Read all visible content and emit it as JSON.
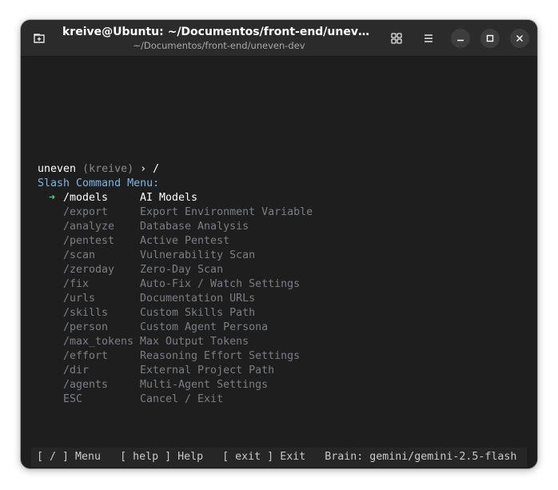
{
  "window": {
    "title": "kreive@Ubuntu: ~/Documentos/front-end/uneven-d...",
    "subtitle": "~/Documentos/front-end/uneven-dev"
  },
  "icons": {
    "new_tab": "new-tab-icon",
    "grid": "grid-icon",
    "menu": "hamburger-menu-icon",
    "minimize": "minimize-icon",
    "maximize": "maximize-icon",
    "close": "close-icon"
  },
  "prompt": {
    "app": "uneven",
    "user": "(kreive)",
    "arrow": "›",
    "input": "/"
  },
  "menu_title": "Slash Command Menu:",
  "selector": "➜",
  "commands": [
    {
      "cmd": "/models",
      "desc": "AI Models"
    },
    {
      "cmd": "/export",
      "desc": "Export Environment Variable"
    },
    {
      "cmd": "/analyze",
      "desc": "Database Analysis"
    },
    {
      "cmd": "/pentest",
      "desc": "Active Pentest"
    },
    {
      "cmd": "/scan",
      "desc": "Vulnerability Scan"
    },
    {
      "cmd": "/zeroday",
      "desc": "Zero-Day Scan"
    },
    {
      "cmd": "/fix",
      "desc": "Auto-Fix / Watch Settings"
    },
    {
      "cmd": "/urls",
      "desc": "Documentation URLs"
    },
    {
      "cmd": "/skills",
      "desc": "Custom Skills Path"
    },
    {
      "cmd": "/person",
      "desc": "Custom Agent Persona"
    },
    {
      "cmd": "/max_tokens",
      "desc": "Max Output Tokens"
    },
    {
      "cmd": "/effort",
      "desc": "Reasoning Effort Settings"
    },
    {
      "cmd": "/dir",
      "desc": "External Project Path"
    },
    {
      "cmd": "/agents",
      "desc": "Multi-Agent Settings"
    },
    {
      "cmd": "ESC",
      "desc": "Cancel / Exit"
    }
  ],
  "status": {
    "menu": "[ / ] Menu",
    "help": "[ help ] Help",
    "exit": "[ exit ] Exit",
    "brain": "Brain: gemini/gemini-2.5-flash"
  },
  "colors": {
    "terminal_bg": "#1e1e1e",
    "titlebar_bg": "#2b2b2b",
    "accent_blue": "#7fb5e6",
    "selector_green": "#4fd06a"
  }
}
